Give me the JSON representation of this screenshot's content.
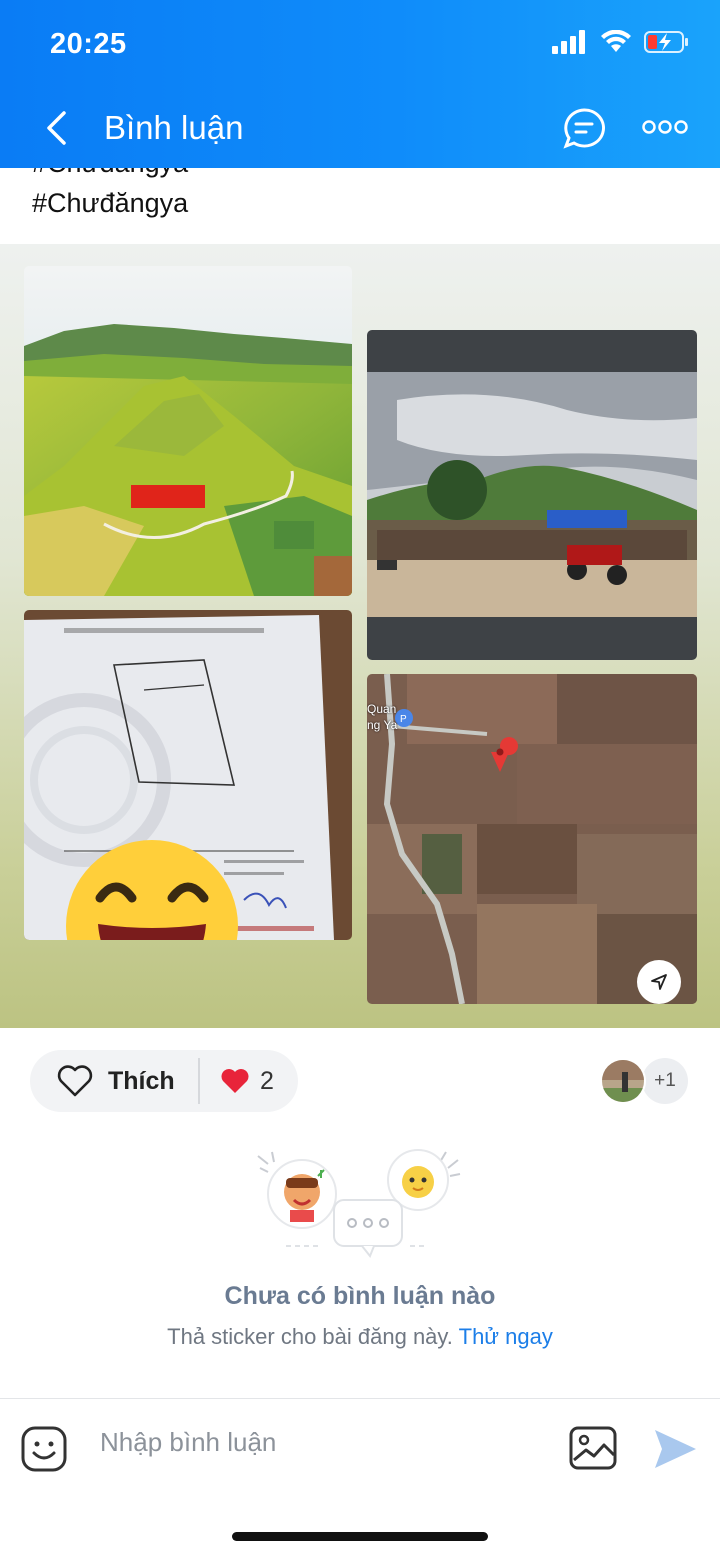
{
  "status_bar": {
    "time": "20:25"
  },
  "nav": {
    "title": "Bình luận"
  },
  "post": {
    "hashtag_cut": "#Chưđăngya",
    "hashtag": "#Chưđăngya"
  },
  "photos": {
    "map_label": "Quan",
    "map_label2": "ng Ya"
  },
  "reactions": {
    "like_label": "Thích",
    "heart_count": "2",
    "extra_viewers": "+1"
  },
  "comments": {
    "empty_title": "Chưa có bình luận nào",
    "empty_subtitle": "Thả sticker cho bài đăng này.",
    "try_link": "Thử ngay"
  },
  "composer": {
    "placeholder": "Nhập bình luận"
  },
  "colors": {
    "header_blue": "#0a7cf5",
    "link_blue": "#1c7ee8",
    "heart_red": "#e8243a"
  }
}
